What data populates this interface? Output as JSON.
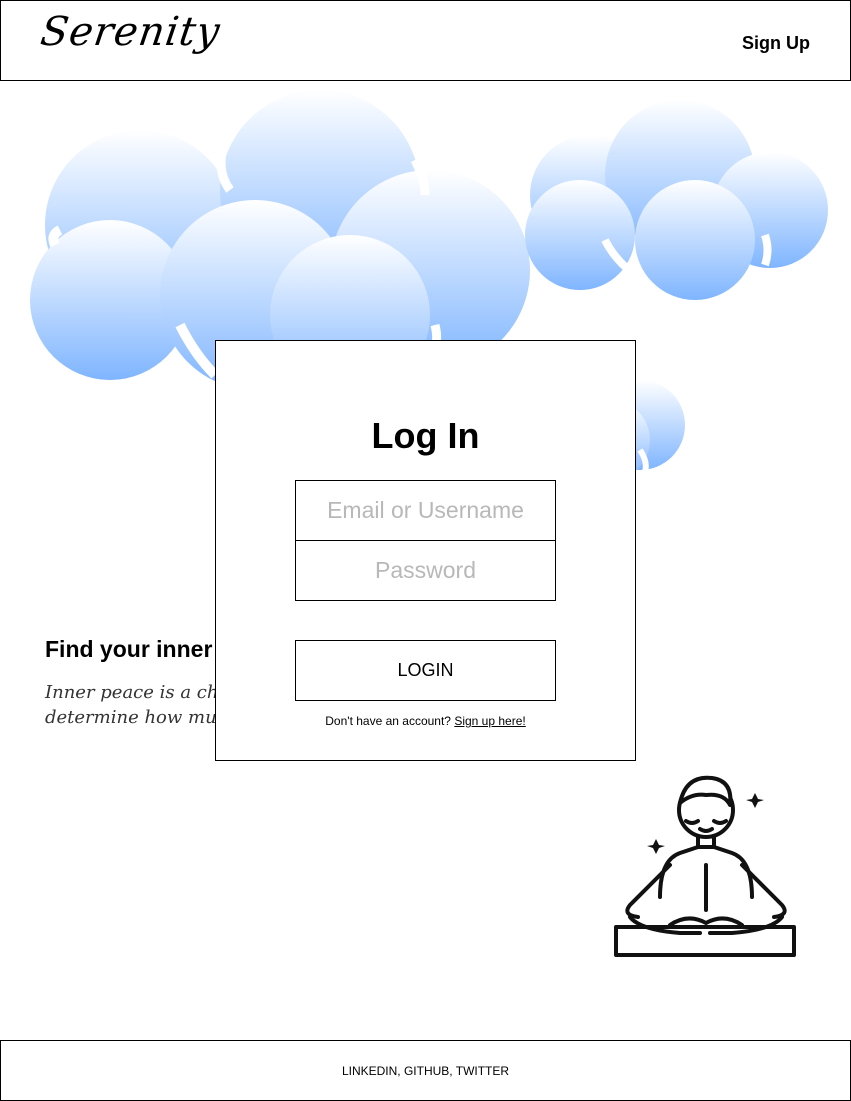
{
  "header": {
    "logo": "Serenity",
    "signup_label": "Sign Up"
  },
  "login": {
    "title": "Log In",
    "email_placeholder": "Email or Username",
    "password_placeholder": "Password",
    "button_label": "LOGIN",
    "prompt_text": "Don't have an account?",
    "signup_link": "Sign up here!"
  },
  "section": {
    "title": "Find your inner peace",
    "body": "Inner peace is a choice. Your thoughts and habits determine how much calm you experience in your day."
  },
  "footer": {
    "links": "LINKEDIN, GITHUB, TWITTER"
  },
  "colors": {
    "cloud_top": "#ffffff",
    "cloud_bottom": "#7fb5ff",
    "border": "#000000",
    "placeholder": "#b8b8b8"
  },
  "icons": [
    "cloud-icon",
    "meditation-person-icon",
    "sparkle-icon"
  ]
}
